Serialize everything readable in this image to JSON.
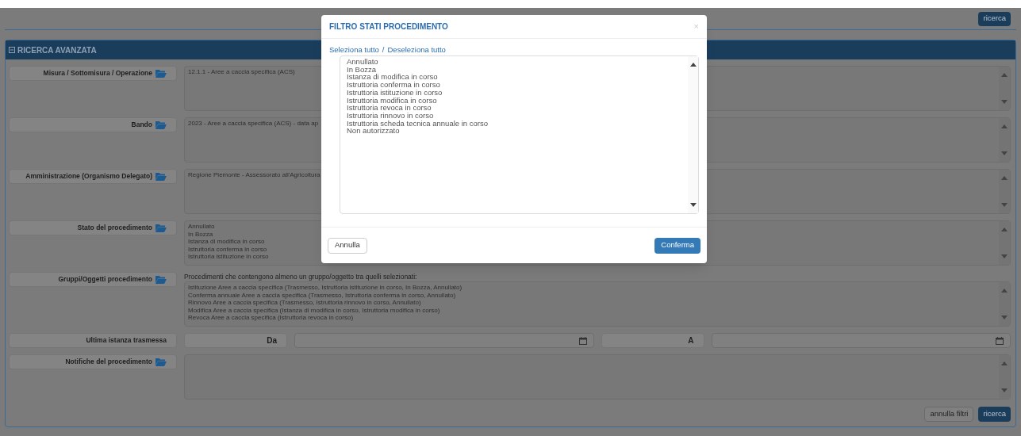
{
  "top_bar": {
    "button": "ricerca"
  },
  "section": {
    "title": "RICERCA AVANZATA",
    "expanded": true
  },
  "fields": [
    {
      "kind": "textarea",
      "label": "Misura / Sottomisura / Operazione",
      "lines": [
        "12.1.1 - Aree a caccia specifica (ACS)"
      ]
    },
    {
      "kind": "textarea",
      "label": "Bando",
      "lines": [
        "2023 - Aree a caccia specifica (ACS) - data ap"
      ]
    },
    {
      "kind": "textarea",
      "label": "Amministrazione (Organismo Delegato)",
      "lines": [
        "Regione Piemonte - Assessorato all'Agricoltura"
      ]
    },
    {
      "kind": "textarea",
      "label": "Stato del procedimento",
      "lines": [
        "Annullato",
        "In Bozza",
        "Istanza di modifica in corso",
        "Istruttoria conferma in corso",
        "Istruttoria istituzione in corso"
      ]
    },
    {
      "kind": "textarea",
      "label": "Gruppi/Oggetti procedimento",
      "note": "Procedimenti che contengono almeno un gruppo/oggetto tra quelli selezionati:",
      "lines": [
        "Istituzione Aree a caccia specifica (Trasmesso, Istruttoria istituzione in corso, In Bozza, Annullato)",
        "Conferma annuale Aree a caccia specifica (Trasmesso, Istruttoria conferma in corso, Annullato)",
        "Rinnovo Aree a caccia specifica (Trasmesso, Istruttoria rinnovo in corso, Annullato)",
        "Modifica Aree a caccia specifica (Istanza di modifica in corso, Istruttoria modifica in corso)",
        "Revoca Aree a caccia specifica (Istruttoria revoca in corso)"
      ]
    },
    {
      "kind": "daterange",
      "label": "Ultima istanza trasmessa",
      "from_label": "Da",
      "to_label": "A"
    },
    {
      "kind": "textarea",
      "label": "Notifiche del procedimento"
    }
  ],
  "footer_buttons": [
    {
      "kind": "secondary",
      "label": "annulla filtri"
    },
    {
      "kind": "primary",
      "label": "ricerca"
    }
  ],
  "modal": {
    "title": "FILTRO STATI PROCEDIMENTO",
    "close": "×",
    "links": [
      "Seleziona tutto",
      "Deseleziona tutto"
    ],
    "separator": "/",
    "options": [
      "Annullato",
      "In Bozza",
      "Istanza di modifica in corso",
      "Istruttoria conferma in corso",
      "Istruttoria istituzione in corso",
      "Istruttoria modifica in corso",
      "Istruttoria revoca in corso",
      "Istruttoria rinnovo in corso",
      "Istruttoria scheda tecnica annuale in corso",
      "Non autorizzato"
    ],
    "cancel": "Annulla",
    "confirm": "Conferma"
  }
}
